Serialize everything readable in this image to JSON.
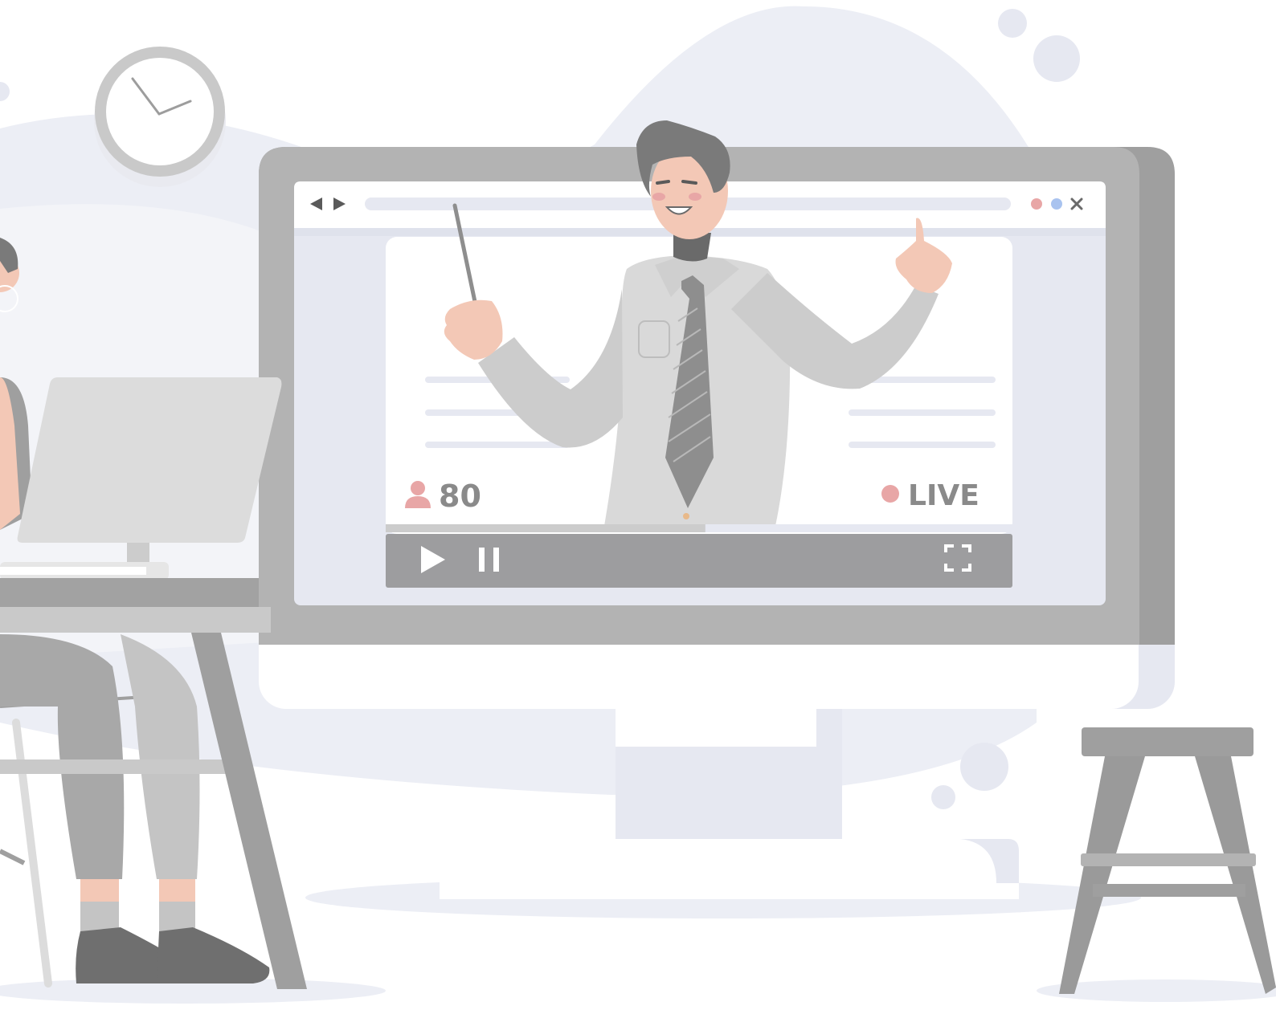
{
  "stream": {
    "viewer_count": "80",
    "live_label": "LIVE"
  },
  "browser": {
    "nav_icons": [
      "back-arrow-icon",
      "forward-arrow-icon"
    ],
    "window_dots": [
      "red-dot",
      "blue-dot"
    ],
    "close_icon": "close-icon"
  },
  "player": {
    "controls": [
      "play-icon",
      "pause-icon",
      "fullscreen-icon"
    ],
    "progress_fraction": 0.51
  },
  "colors": {
    "live_dot": "#e8a6a6",
    "viewer_icon": "#e8a6a6",
    "dot_blue": "#a9c3ef",
    "monitor_frame": "#b3b3b3",
    "control_bar": "#9d9d9f"
  }
}
